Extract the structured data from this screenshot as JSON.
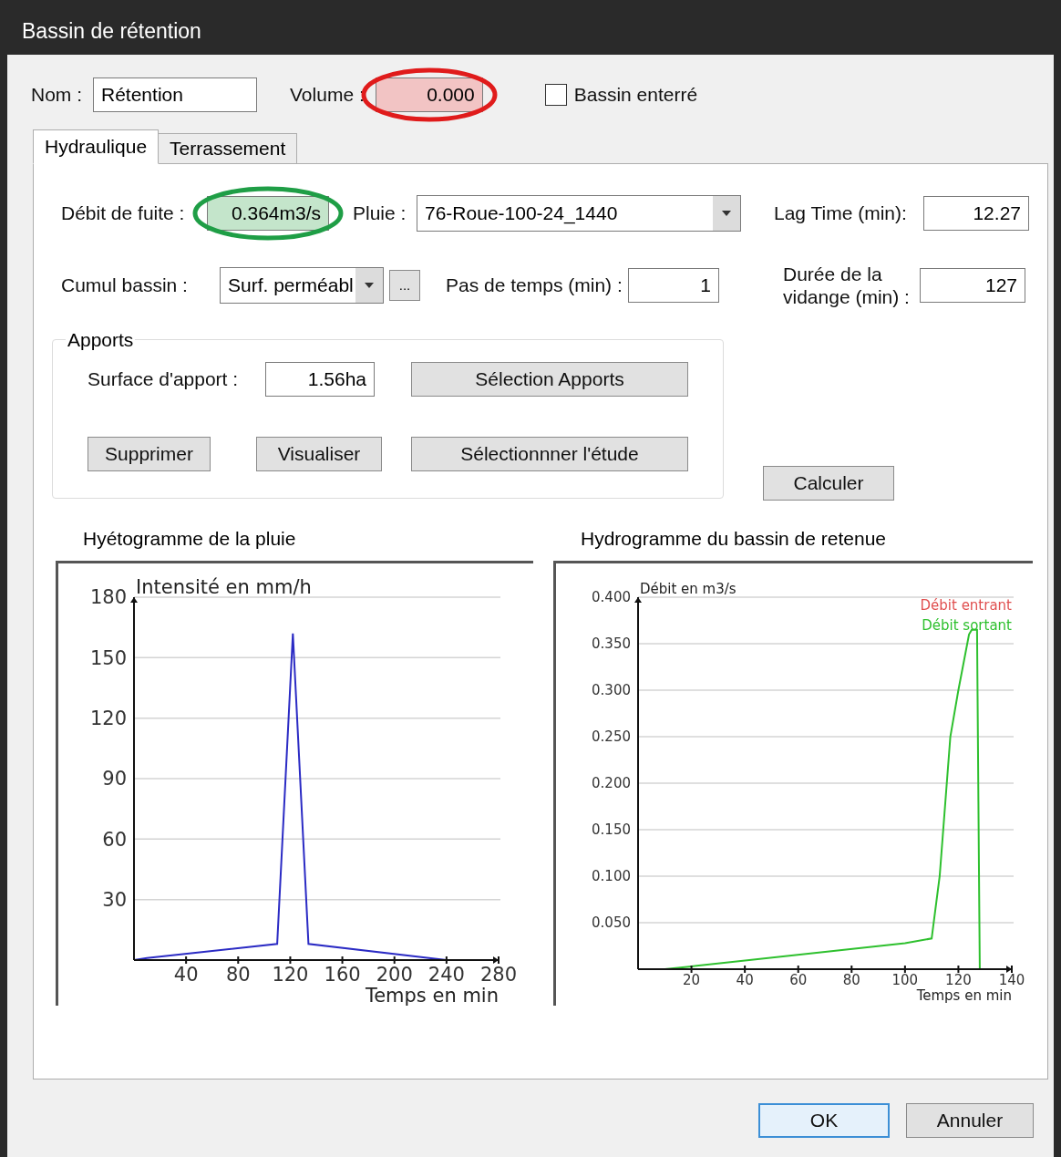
{
  "window": {
    "title": "Bassin de rétention"
  },
  "header": {
    "name": {
      "label": "Nom :",
      "value": "Rétention"
    },
    "volume": {
      "label": "Volume :",
      "value": "0.000",
      "highlight": {
        "color": "#f2c4c4"
      },
      "ring": {
        "color": "#e01b1b"
      }
    },
    "buried": {
      "label": "Bassin enterré",
      "checked": false
    }
  },
  "tabs": [
    {
      "label": "Hydraulique",
      "selected": true
    },
    {
      "label": "Terrassement",
      "selected": false
    }
  ],
  "hydraulics": {
    "leak_flow": {
      "label": "Débit de fuite :",
      "value": "0.364m3/s",
      "highlight": {
        "color": "#c4e5cb"
      },
      "ring": {
        "color": "#1f9e46"
      }
    },
    "rain": {
      "label": "Pluie :",
      "value": "76-Roue-100-24_1440"
    },
    "lag_time": {
      "label": "Lag Time (min):",
      "value": "12.27"
    },
    "cumul": {
      "label": "Cumul bassin :",
      "value": "Surf. perméabl",
      "more_button": "..."
    },
    "time_step": {
      "label": "Pas de temps (min) :",
      "value": "1"
    },
    "drain_time": {
      "label": "Durée de la vidange (min) :",
      "value": "127"
    },
    "apports": {
      "title": "Apports",
      "surface": {
        "label": "Surface d'apport :",
        "value": "1.56ha"
      },
      "select_button": "Sélection Apports",
      "buttons": [
        "Supprimer",
        "Visualiser",
        "Sélectionnner l'étude"
      ]
    },
    "calculate_button": "Calculer"
  },
  "charts": [
    {
      "title": "Hyétogramme de la pluie",
      "chart_data": {
        "type": "line",
        "ylabel": "Intensité en mm/h",
        "xlabel": "Temps en min",
        "x": [
          0,
          10,
          110,
          122,
          134,
          240
        ],
        "series": [
          {
            "color": "#2b2bc4",
            "values": [
              0,
              1,
              8,
              162,
              8,
              0
            ]
          }
        ],
        "xlim": [
          0,
          280
        ],
        "ylim": [
          0,
          180
        ],
        "xticks": [
          40,
          80,
          120,
          160,
          200,
          240,
          280
        ],
        "yticks": [
          30,
          60,
          90,
          120,
          150,
          180
        ],
        "grid": true
      }
    },
    {
      "title": "Hydrogramme du bassin de retenue",
      "chart_data": {
        "type": "line",
        "ylabel": "Débit en m3/s",
        "xlabel": "Temps en min",
        "x": [
          0,
          10,
          20,
          100,
          110,
          113,
          117,
          120,
          124,
          125,
          127,
          127.5,
          128
        ],
        "series": [
          {
            "name": "Débit entrant",
            "color": "#e05050",
            "values": [
              null,
              null,
              null,
              null,
              null,
              null,
              null,
              null,
              null,
              null,
              null,
              null,
              null
            ]
          },
          {
            "name": "Débit sortant",
            "color": "#2ec02e",
            "values": [
              0,
              0,
              0.003,
              0.028,
              0.033,
              0.1,
              0.25,
              0.3,
              0.36,
              0.365,
              0.365,
              0.18,
              0
            ]
          }
        ],
        "xlim": [
          0,
          140
        ],
        "ylim": [
          0,
          0.4
        ],
        "xticks": [
          20,
          40,
          60,
          80,
          100,
          120,
          140
        ],
        "yticks": [
          {
            "value": 0.05,
            "label": "0.050"
          },
          {
            "value": 0.1,
            "label": "0.100"
          },
          {
            "value": 0.15,
            "label": "0.150"
          },
          {
            "value": 0.2,
            "label": "0.200"
          },
          {
            "value": 0.25,
            "label": "0.250"
          },
          {
            "value": 0.3,
            "label": "0.300"
          },
          {
            "value": 0.35,
            "label": "0.350"
          },
          {
            "value": 0.4,
            "label": "0.400"
          }
        ],
        "grid": true
      }
    }
  ],
  "buttons": [
    {
      "label": "OK",
      "default": true
    },
    {
      "label": "Annuler",
      "default": false
    }
  ]
}
